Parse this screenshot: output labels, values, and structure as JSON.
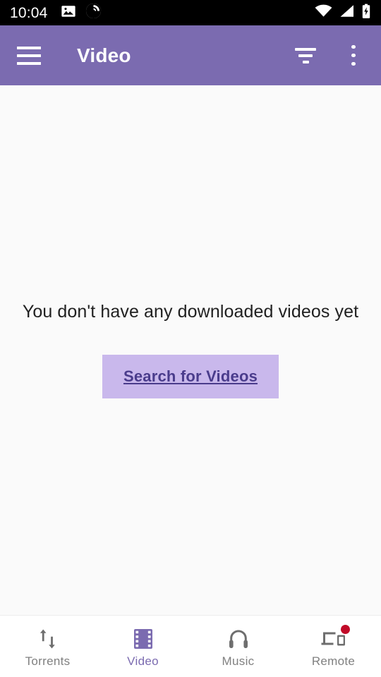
{
  "status_bar": {
    "clock": "10:04",
    "left_icons": [
      "image-icon",
      "bittorrent-logo-icon"
    ],
    "right_icons": [
      "wifi-icon",
      "cellular-signal-icon",
      "battery-charging-icon"
    ],
    "background_color": "#000000",
    "foreground_color": "#ffffff"
  },
  "app_bar": {
    "title": "Video",
    "menu_icon": "hamburger-menu-icon",
    "filter_icon": "filter-list-icon",
    "overflow_icon": "more-vertical-icon",
    "background_color": "#7b6bb0",
    "text_color": "#ffffff"
  },
  "main": {
    "empty_state_message": "You don't have any downloaded videos yet",
    "search_button_label": "Search for Videos",
    "search_button_bg": "#c9b8ec",
    "search_button_text_color": "#4a3c8c",
    "background_color": "#fafafa"
  },
  "bottom_nav": {
    "active_color": "#7b6bb0",
    "inactive_color": "#808080",
    "badge_color": "#c10a28",
    "items": [
      {
        "label": "Torrents",
        "icon": "transfer-arrows-icon",
        "active": false,
        "badge": false
      },
      {
        "label": "Video",
        "icon": "film-strip-icon",
        "active": true,
        "badge": false
      },
      {
        "label": "Music",
        "icon": "headphones-icon",
        "active": false,
        "badge": false
      },
      {
        "label": "Remote",
        "icon": "remote-devices-icon",
        "active": false,
        "badge": true
      }
    ]
  }
}
